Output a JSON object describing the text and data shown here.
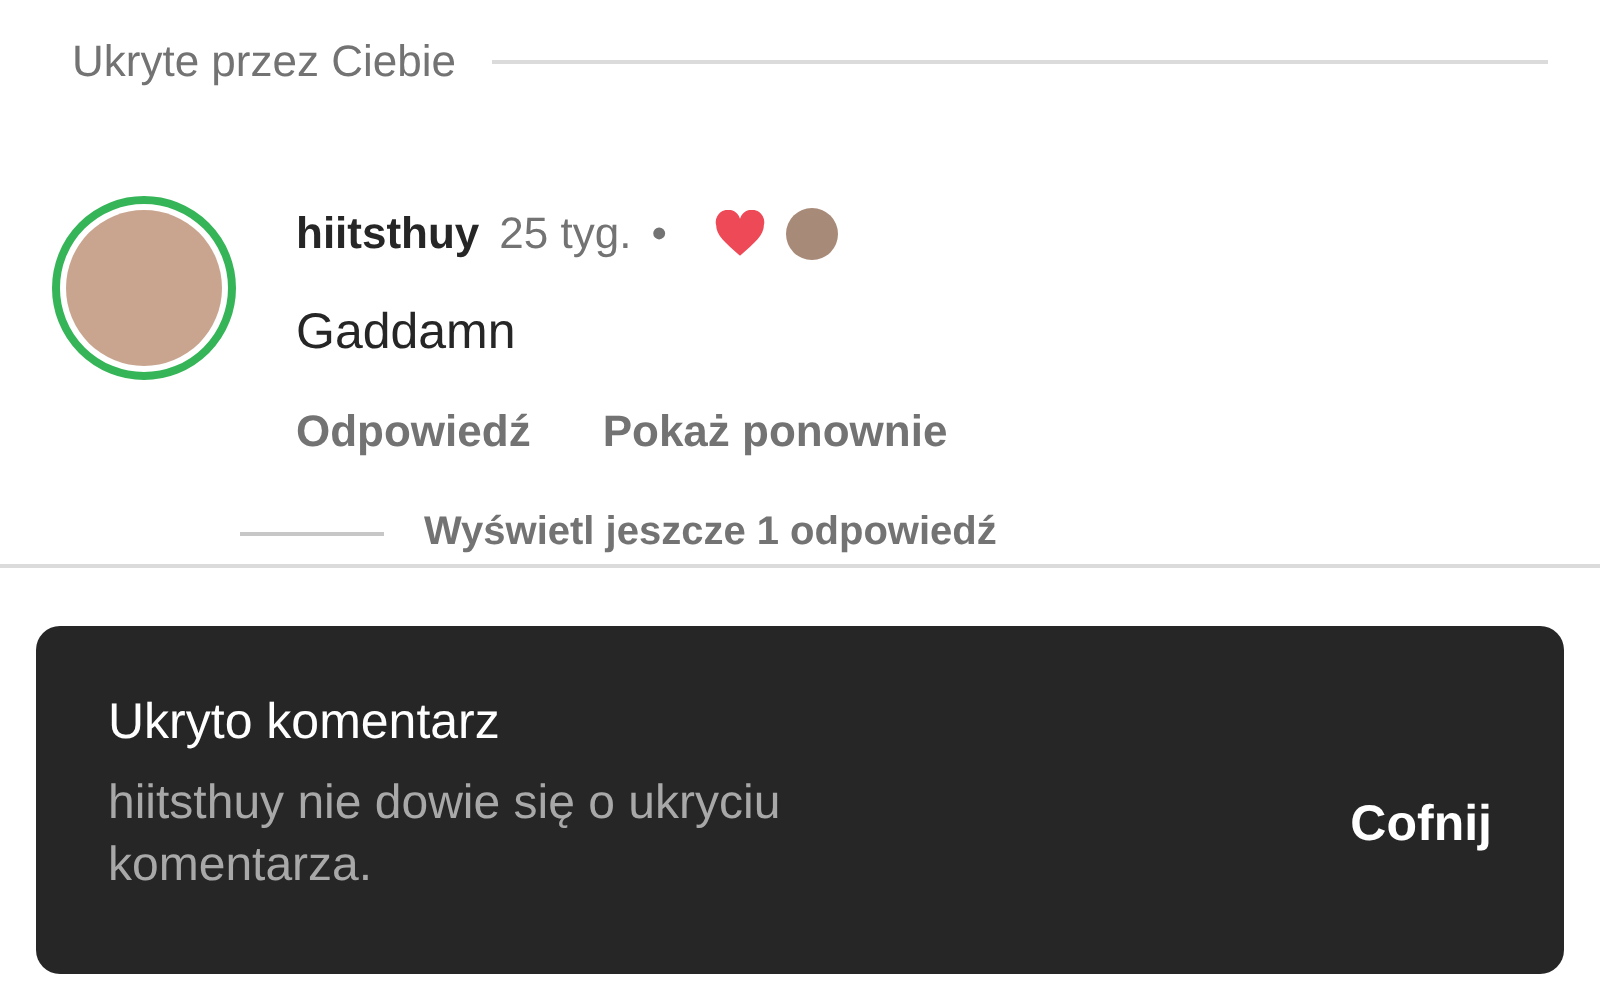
{
  "section": {
    "title": "Ukryte przez Ciebie"
  },
  "comment": {
    "username": "hiitsthuy",
    "time": "25 tyg.",
    "separator": "•",
    "liked_by_author": true,
    "text": "Gaddamn",
    "actions": [
      "Odpowiedź",
      "Pokaż ponownie"
    ],
    "view_replies": "Wyświetl jeszcze 1 odpowiedź",
    "story_ring": true
  },
  "snackbar": {
    "title": "Ukryto komentarz",
    "message": "hiitsthuy nie dowie się o ukryciu komentarza.",
    "action": "Cofnij"
  }
}
